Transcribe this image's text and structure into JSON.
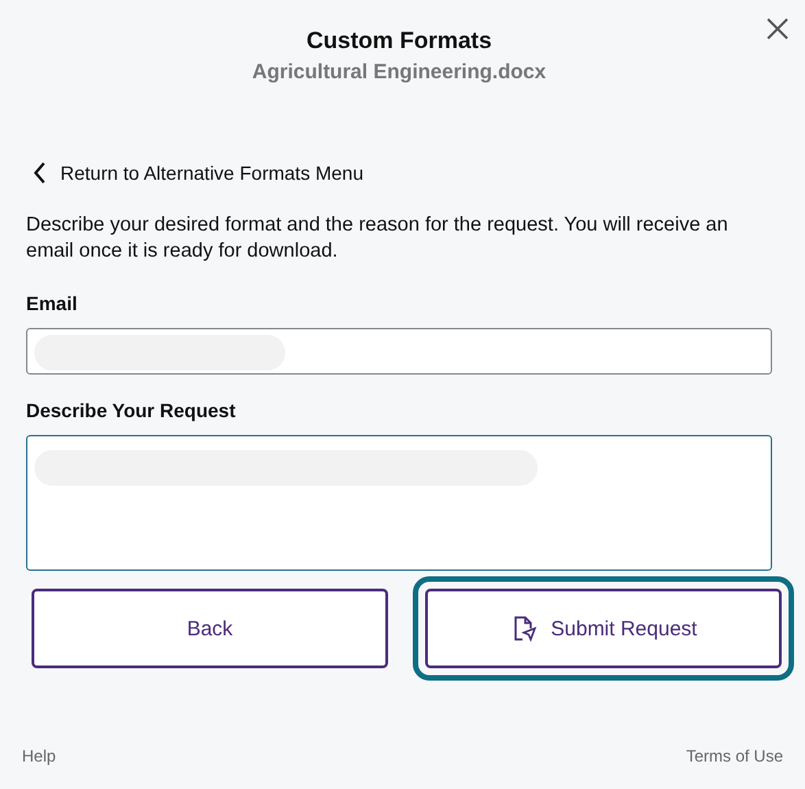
{
  "dialog": {
    "title": "Custom Formats",
    "subtitle": "Agricultural Engineering.docx"
  },
  "back_link": {
    "label": "Return to Alternative Formats Menu"
  },
  "description": "Describe your desired format and the reason for the request. You will receive an email once it is ready for download.",
  "fields": [
    {
      "label": "Email",
      "kind": "input",
      "focused": false
    },
    {
      "label": "Describe Your Request",
      "kind": "textarea",
      "focused": true
    }
  ],
  "buttons": [
    {
      "label": "Back",
      "kind": "plain",
      "focused": false
    },
    {
      "label": "Submit Request",
      "kind": "submit",
      "focused": true
    }
  ],
  "footer": {
    "help": "Help",
    "terms": "Terms of Use"
  }
}
